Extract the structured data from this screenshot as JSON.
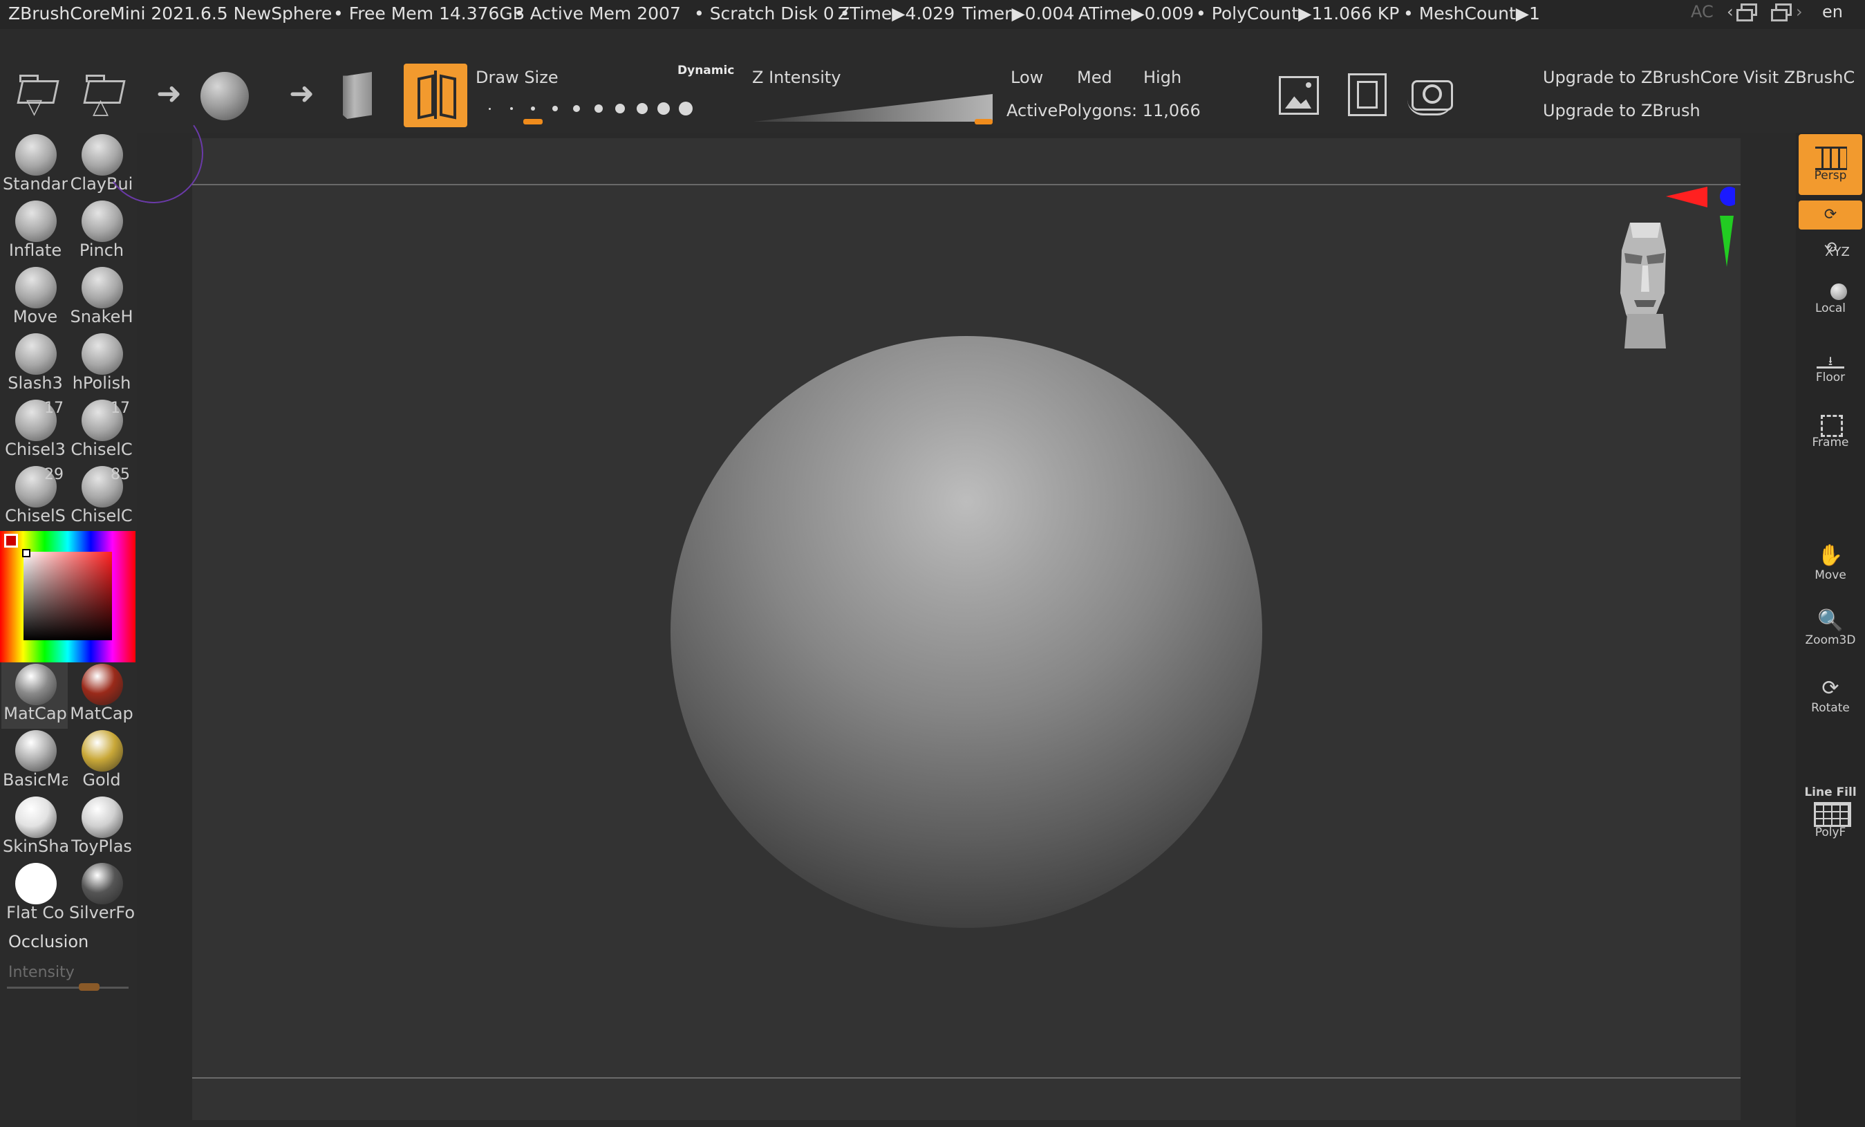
{
  "title_bar": {
    "app": "ZBrushCoreMini 2021.6.5 NewSphere",
    "free_mem": "• Free Mem 14.376GB",
    "active_mem": "• Active Mem 2007",
    "scratch": "• Scratch Disk 0 •",
    "ztime": "ZTime▶4.029",
    "timer": "Timer▶0.004",
    "atime": "ATime▶0.009",
    "polycount": "• PolyCount▶11.066 KP",
    "meshcount": "• MeshCount▶1",
    "ac": "AC",
    "lang": "en"
  },
  "shelf": {
    "draw_size_label": "Draw Size",
    "dynamic_label": "Dynamic",
    "z_intensity_label": "Z Intensity",
    "low": "Low",
    "med": "Med",
    "high": "High",
    "active_polygons": "ActivePolygons: 11,066",
    "upgrade_core": "Upgrade to ZBrushCore",
    "upgrade_zbrush": "Upgrade to ZBrush",
    "visit": "Visit ZBrushC",
    "draw_size_level": 0.25,
    "z_intensity_level": 1.0
  },
  "brushes": [
    {
      "name": "Standar"
    },
    {
      "name": "ClayBui"
    },
    {
      "name": "Inflate"
    },
    {
      "name": "Pinch"
    },
    {
      "name": "Move"
    },
    {
      "name": "SnakeH"
    },
    {
      "name": "Slash3"
    },
    {
      "name": "hPolish"
    },
    {
      "name": "Chisel3",
      "count": "17"
    },
    {
      "name": "ChiselC",
      "count": "17"
    },
    {
      "name": "ChiselS",
      "count": "29"
    },
    {
      "name": "ChiselC",
      "count": "85"
    }
  ],
  "materials": [
    {
      "name": "MatCap",
      "color": "#8a8a8a"
    },
    {
      "name": "MatCap",
      "color": "#9a2a1a"
    },
    {
      "name": "BasicMa",
      "color": "#b0b0b0"
    },
    {
      "name": "Gold",
      "color": "#c9a838"
    },
    {
      "name": "SkinSha",
      "color": "#e2e2e2"
    },
    {
      "name": "ToyPlas",
      "color": "#d0d0d0"
    },
    {
      "name": "Flat Co",
      "color": "#ffffff"
    },
    {
      "name": "SilverFo",
      "color": "#555555"
    }
  ],
  "left_tray": {
    "occlusion": "Occlusion",
    "intensity": "Intensity"
  },
  "right_tray": {
    "persp": "Persp",
    "xyz": "XYZ",
    "local": "Local",
    "floor": "Floor",
    "frame": "Frame",
    "move": "Move",
    "zoom3d": "Zoom3D",
    "rotate": "Rotate",
    "line_fill": "Line Fill",
    "polyf": "PolyF"
  },
  "colors": {
    "accent": "#f29a2e",
    "gizmo_x": "#ff2020",
    "gizmo_y": "#22cc22",
    "gizmo_z": "#1a1aff"
  }
}
